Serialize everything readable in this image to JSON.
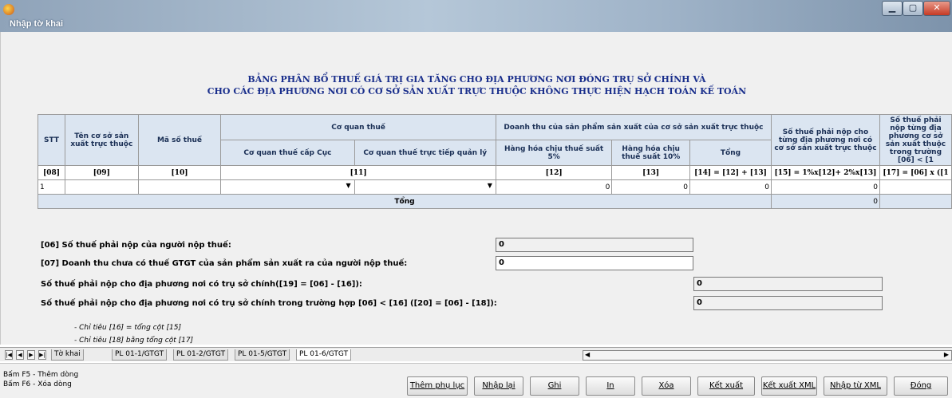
{
  "window": {
    "title": "",
    "subtitle": "Nhập tờ khai",
    "controls": {
      "minimize": "▁",
      "maximize": "▢",
      "close": "✕"
    }
  },
  "page": {
    "title_line1": "BẢNG PHÂN BỔ THUẾ GIÁ TRỊ GIA TĂNG CHO ĐỊA PHƯƠNG NƠI ĐÓNG TRỤ SỞ CHÍNH VÀ",
    "title_line2": "CHO CÁC ĐỊA PHƯƠNG NƠI CÓ CƠ SỞ SẢN XUẤT TRỰC THUỘC KHÔNG THỰC HIỆN HẠCH TOÁN KẾ TOÁN"
  },
  "table": {
    "headers": {
      "stt": "STT",
      "ten_co_so": "Tên cơ sở sản xuất trực thuộc",
      "ma_so_thue": "Mã số thuế",
      "co_quan_thue": "Cơ quan thuế",
      "cq_cap_cuc": "Cơ quan thuế cấp Cục",
      "cq_truc_tiep": "Cơ quan thuế trực tiếp quản lý",
      "doanh_thu": "Doanh thu của sản phẩm sản xuất của cơ sở sản xuất trực thuộc",
      "hh_5": "Hàng hóa chịu thuế suất 5%",
      "hh_10": "Hàng hóa chịu thuế suất 10%",
      "tong": "Tổng",
      "so_thue_dp": "Số thuế phải nộp cho từng địa phương nơi có cơ sở sản xuất trực thuộc",
      "so_thue_dp2": "Số thuế phải nộp từng địa phương cơ sở sản xuất thuộc trong trường [06] < [1"
    },
    "codes": [
      "[08]",
      "[09]",
      "[10]",
      "[11]",
      "[12]",
      "[13]",
      "[14] = [12] + [13]",
      "[15] = 1%x[12]+ 2%x[13]",
      "[17] = [06] x ([1"
    ],
    "row": {
      "stt": "1",
      "v12": "0",
      "v13": "0",
      "v14": "0",
      "v15": "0"
    },
    "total_label": "Tổng",
    "total_value": "0"
  },
  "form": {
    "f06_label": "[06] Số thuế phải nộp của người nộp thuế:",
    "f06_value": "0",
    "f07_label": "[07] Doanh thu chưa có thuế GTGT của sản phẩm sản xuất ra của người nộp thuế:",
    "f07_value": "0",
    "f19_label": "Số thuế phải nộp cho địa phương  nơi có trụ sở chính([19] = [06] - [16]):",
    "f19_value": "0",
    "f20_label": "Số thuế phải nộp cho địa phương nơi có trụ sở chính trong trường hợp [06] < [16]  ([20] = [06] - [18]):",
    "f20_value": "0",
    "note1": "- Chỉ tiêu [16] = tổng cột [15]",
    "note2": "- Chỉ tiêu [18] bằng tổng cột [17]"
  },
  "tabs": {
    "nav": [
      "|◀",
      "◀",
      "▶",
      "▶|"
    ],
    "items": [
      "Tờ khai",
      "PL 01-1/GTGT",
      "PL 01-2/GTGT",
      "PL 01-5/GTGT",
      "PL 01-6/GTGT"
    ],
    "active": "PL 01-6/GTGT"
  },
  "status": {
    "hint1": "Bấm F5 - Thêm dòng",
    "hint2": "Bấm F6 - Xóa dòng"
  },
  "buttons": [
    "Thêm phụ lục",
    "Nhập lại",
    "Ghi",
    "In",
    "Xóa",
    "Kết xuất",
    "Kết xuất XML",
    "Nhập từ XML",
    "Đóng"
  ]
}
